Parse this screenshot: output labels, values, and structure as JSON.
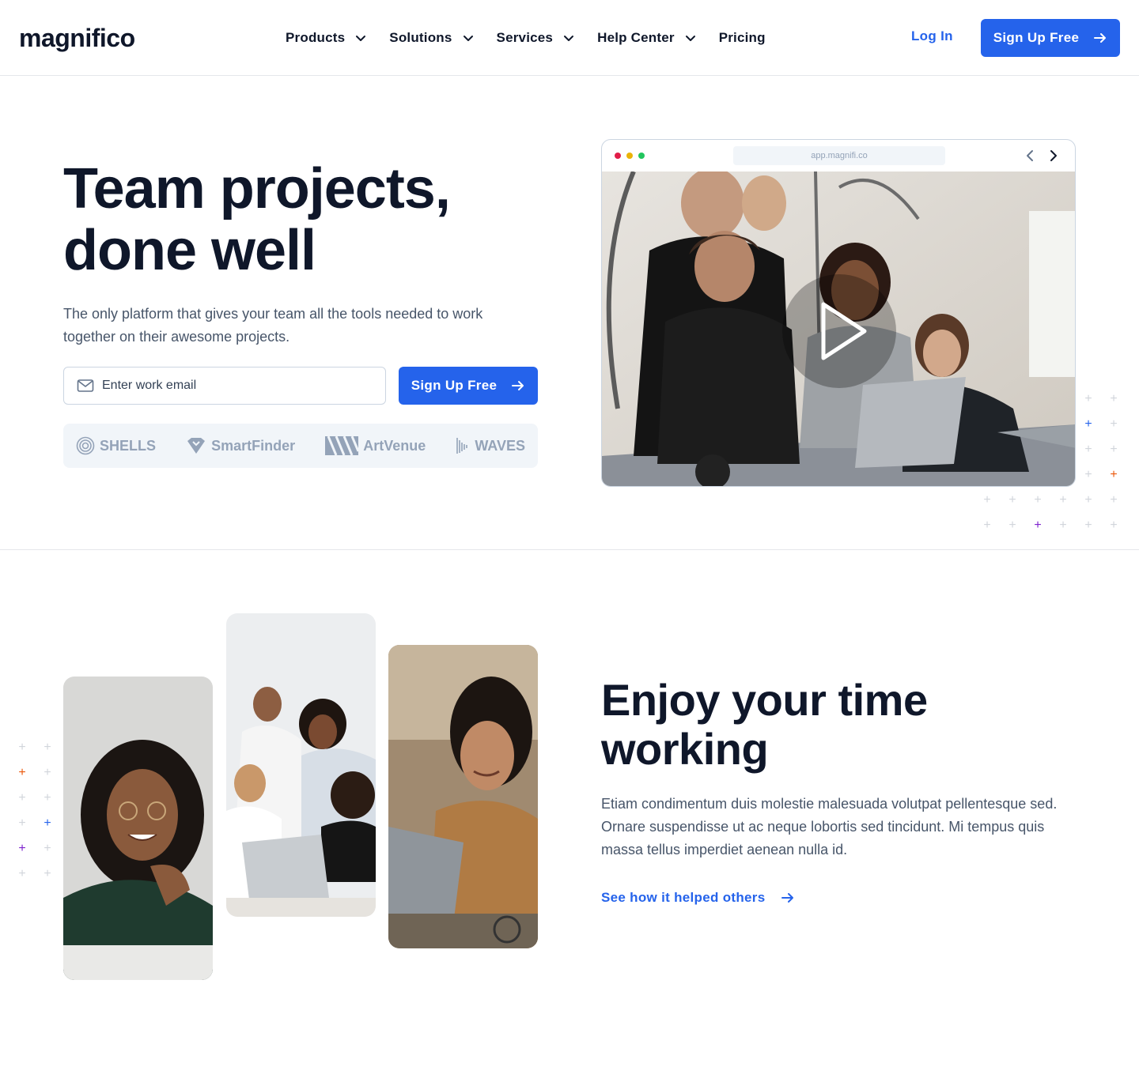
{
  "brand": {
    "logo_text": "magnifico"
  },
  "nav": {
    "items": [
      {
        "label": "Products",
        "has_dropdown": true
      },
      {
        "label": "Solutions",
        "has_dropdown": true
      },
      {
        "label": "Services",
        "has_dropdown": true
      },
      {
        "label": "Help Center",
        "has_dropdown": true
      },
      {
        "label": "Pricing",
        "has_dropdown": false
      }
    ],
    "login_label": "Log In",
    "signup_label": "Sign Up Free"
  },
  "hero": {
    "title_line1": "Team projects,",
    "title_line2": "done well",
    "subtitle": "The only platform that gives your team all the tools needed to work together on their awesome projects.",
    "email_placeholder": "Enter work email",
    "signup_label": "Sign Up Free",
    "partner_logos": [
      "SHELLS",
      "SmartFinder",
      "ArtVenue",
      "WAVES"
    ]
  },
  "browser": {
    "url": "app.magnifi.co",
    "icons": [
      "chevron-left-icon",
      "chevron-right-icon",
      "play-icon"
    ]
  },
  "feature": {
    "title_line1": "Enjoy your time",
    "title_line2": "working",
    "body": "Etiam condimentum duis molestie malesuada volutpat pellentesque sed. Ornare suspendisse ut ac neque lobortis sed tincidunt. Mi tempus quis massa tellus imperdiet aenean nulla id.",
    "link_label": "See how it helped others"
  },
  "colors": {
    "accent": "#2563eb",
    "heading": "#0f172a",
    "body_text": "#475569",
    "logo_gray": "#94a3b8",
    "dot_red": "#e11d48",
    "dot_yellow": "#eab308",
    "dot_green": "#22c55e",
    "plus_orange": "#ea580c",
    "plus_blue": "#2563eb",
    "plus_purple": "#7e22ce"
  }
}
